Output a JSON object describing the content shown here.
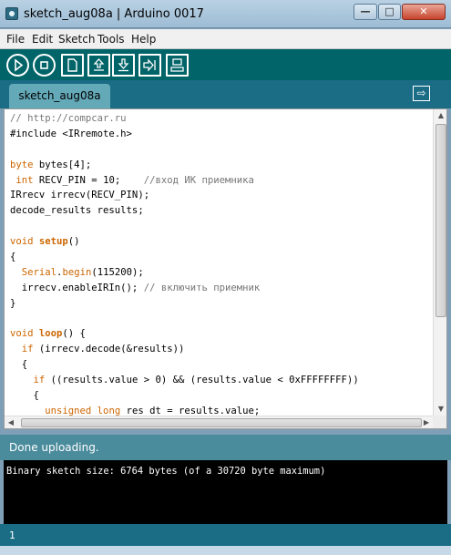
{
  "window": {
    "title": "sketch_aug08a | Arduino 0017"
  },
  "titlebar_buttons": {
    "minimize": "—",
    "maximize": "□",
    "close": "✕"
  },
  "menu": [
    "File",
    "Edit",
    "Sketch",
    "Tools",
    "Help"
  ],
  "toolbar": {
    "buttons": [
      {
        "name": "verify",
        "icon": "play-icon"
      },
      {
        "name": "stop",
        "icon": "stop-icon"
      },
      {
        "name": "new",
        "icon": "new-file-icon"
      },
      {
        "name": "open",
        "icon": "open-icon"
      },
      {
        "name": "save",
        "icon": "save-icon"
      },
      {
        "name": "upload",
        "icon": "upload-icon"
      },
      {
        "name": "serial-monitor",
        "icon": "serial-monitor-icon"
      }
    ]
  },
  "tabs": [
    {
      "label": "sketch_aug08a"
    }
  ],
  "tab_menu_icon": "tab-menu-icon",
  "code": [
    [
      {
        "t": "// http://compcar.ru",
        "c": "comment"
      }
    ],
    [
      {
        "t": "#include <IRremote.h>",
        "c": ""
      }
    ],
    [
      {
        "t": "",
        "c": ""
      }
    ],
    [
      {
        "t": "byte",
        "c": "kw"
      },
      {
        "t": " bytes[4];",
        "c": ""
      }
    ],
    [
      {
        "t": " ",
        "c": ""
      },
      {
        "t": "int",
        "c": "kw"
      },
      {
        "t": " RECV_PIN = 10;    ",
        "c": ""
      },
      {
        "t": "//вход ИК приемника",
        "c": "comment"
      }
    ],
    [
      {
        "t": "IRrecv irrecv(RECV_PIN);",
        "c": ""
      }
    ],
    [
      {
        "t": "decode_results results;",
        "c": ""
      }
    ],
    [
      {
        "t": "",
        "c": ""
      }
    ],
    [
      {
        "t": "void",
        "c": "kw"
      },
      {
        "t": " ",
        "c": ""
      },
      {
        "t": "setup",
        "c": "kwb"
      },
      {
        "t": "()",
        "c": ""
      }
    ],
    [
      {
        "t": "{",
        "c": ""
      }
    ],
    [
      {
        "t": "  ",
        "c": ""
      },
      {
        "t": "Serial",
        "c": "fn"
      },
      {
        "t": ".",
        "c": ""
      },
      {
        "t": "begin",
        "c": "fn"
      },
      {
        "t": "(115200);",
        "c": ""
      }
    ],
    [
      {
        "t": "  irrecv.enableIRIn(); ",
        "c": ""
      },
      {
        "t": "// включить приемник",
        "c": "comment"
      }
    ],
    [
      {
        "t": "}",
        "c": ""
      }
    ],
    [
      {
        "t": "",
        "c": ""
      }
    ],
    [
      {
        "t": "void",
        "c": "kw"
      },
      {
        "t": " ",
        "c": ""
      },
      {
        "t": "loop",
        "c": "kwb"
      },
      {
        "t": "() {",
        "c": ""
      }
    ],
    [
      {
        "t": "  ",
        "c": ""
      },
      {
        "t": "if",
        "c": "kw"
      },
      {
        "t": " (irrecv.decode(&results))",
        "c": ""
      }
    ],
    [
      {
        "t": "  {",
        "c": ""
      }
    ],
    [
      {
        "t": "    ",
        "c": ""
      },
      {
        "t": "if",
        "c": "kw"
      },
      {
        "t": " ((results.value > 0) && (results.value < 0xFFFFFFFF))",
        "c": ""
      }
    ],
    [
      {
        "t": "    {",
        "c": ""
      }
    ],
    [
      {
        "t": "      ",
        "c": ""
      },
      {
        "t": "unsigned long",
        "c": "kw"
      },
      {
        "t": " res_dt = results.value;",
        "c": ""
      }
    ]
  ],
  "status": {
    "message": "Done uploading."
  },
  "console": {
    "text": "Binary sketch size: 6764 bytes (of a 30720 byte maximum)"
  },
  "footer": {
    "line_number": "1"
  }
}
